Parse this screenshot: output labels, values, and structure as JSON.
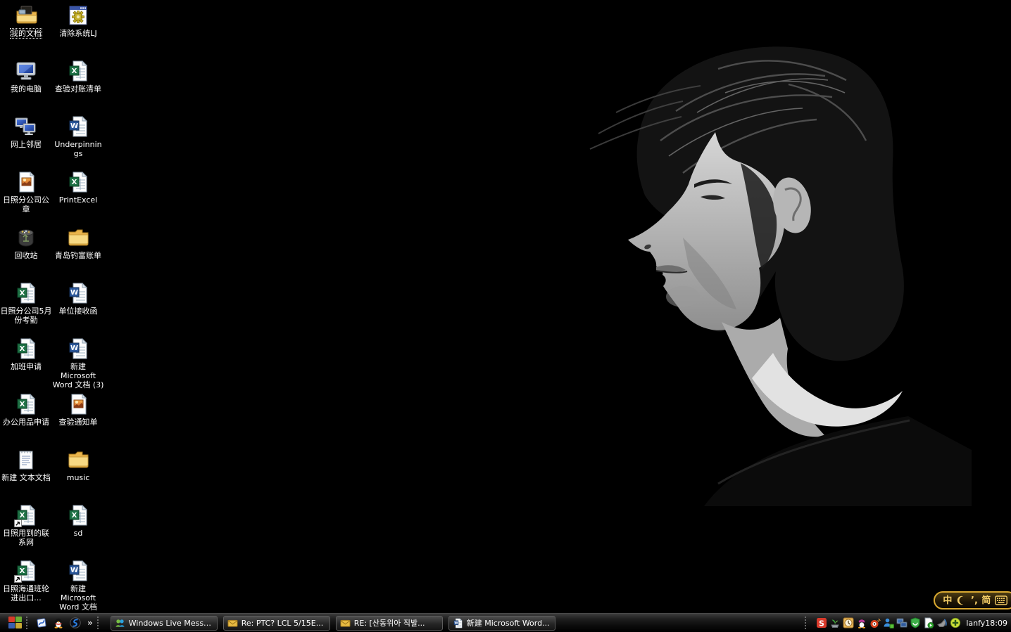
{
  "desktop": {
    "background_color": "#000000",
    "icons": [
      {
        "label": "我的文档",
        "icon": "my-documents",
        "selected": true
      },
      {
        "label": "清除系统LJ",
        "icon": "gear-window-app",
        "selected": false
      },
      {
        "label": "我的电脑",
        "icon": "my-computer",
        "selected": false
      },
      {
        "label": "查验对账清单",
        "icon": "excel-file",
        "selected": false
      },
      {
        "label": "网上邻居",
        "icon": "network-places",
        "selected": false
      },
      {
        "label": "Underpinnings",
        "icon": "word-file",
        "selected": false
      },
      {
        "label": "日照分公司公章",
        "icon": "image-file",
        "selected": false
      },
      {
        "label": "PrintExcel",
        "icon": "excel-file",
        "selected": false
      },
      {
        "label": "回收站",
        "icon": "recycle-bin",
        "selected": false
      },
      {
        "label": "青岛钓富账单",
        "icon": "folder",
        "selected": false
      },
      {
        "label": "日照分公司5月份考勤",
        "icon": "excel-file",
        "selected": false
      },
      {
        "label": "单位接收函",
        "icon": "word-file",
        "selected": false
      },
      {
        "label": "加班申请",
        "icon": "excel-file",
        "selected": false
      },
      {
        "label": "新建 Microsoft Word 文档 (3)",
        "icon": "word-file",
        "selected": false
      },
      {
        "label": "办公用品申请",
        "icon": "excel-file",
        "selected": false
      },
      {
        "label": "查验通知单",
        "icon": "image-file",
        "selected": false
      },
      {
        "label": "新建 文本文档",
        "icon": "text-file",
        "selected": false
      },
      {
        "label": "music",
        "icon": "folder",
        "selected": false
      },
      {
        "label": "日照用到的联系网",
        "icon": "excel-shortcut",
        "selected": false
      },
      {
        "label": "sd",
        "icon": "excel-file",
        "selected": false
      },
      {
        "label": "日照海通班轮进出口...",
        "icon": "excel-shortcut",
        "selected": false
      },
      {
        "label": "新建 Microsoft Word 文档",
        "icon": "word-file",
        "selected": false
      }
    ]
  },
  "taskbar": {
    "quick_launch": {
      "items": [
        {
          "name": "show-desktop"
        },
        {
          "name": "qq-messenger"
        },
        {
          "name": "browser"
        }
      ],
      "overflow_chevron": "»"
    },
    "buttons": [
      {
        "label": "Windows Live Messe...",
        "icon": "messenger-icon"
      },
      {
        "label": "Re: PTC? LCL 5/15E...",
        "icon": "mail-icon"
      },
      {
        "label": "RE: [산동위아 직발...",
        "icon": "mail-icon"
      },
      {
        "label": "新建 Microsoft Word...",
        "icon": "word-icon"
      }
    ],
    "tray": {
      "icons": [
        {
          "name": "sogou-input"
        },
        {
          "name": "green-plant"
        },
        {
          "name": "clock-reminder"
        },
        {
          "name": "qq"
        },
        {
          "name": "sina-uc"
        },
        {
          "name": "messenger-status"
        },
        {
          "name": "network-connection"
        },
        {
          "name": "security-shield"
        },
        {
          "name": "media-document"
        },
        {
          "name": "speaker-horn"
        },
        {
          "name": "antivirus-cross"
        }
      ],
      "user_label": "lanfy",
      "clock": "18:09"
    }
  },
  "ime_bar": {
    "border_color": "#d8a830",
    "items": [
      {
        "name": "chinese-mode",
        "glyph": "中"
      },
      {
        "name": "halfwidth-moon",
        "glyph": ""
      },
      {
        "name": "punctuation-mode",
        "glyph": "’,"
      },
      {
        "name": "simplified-chinese",
        "glyph": "简"
      },
      {
        "name": "soft-keyboard",
        "glyph": ""
      }
    ]
  }
}
